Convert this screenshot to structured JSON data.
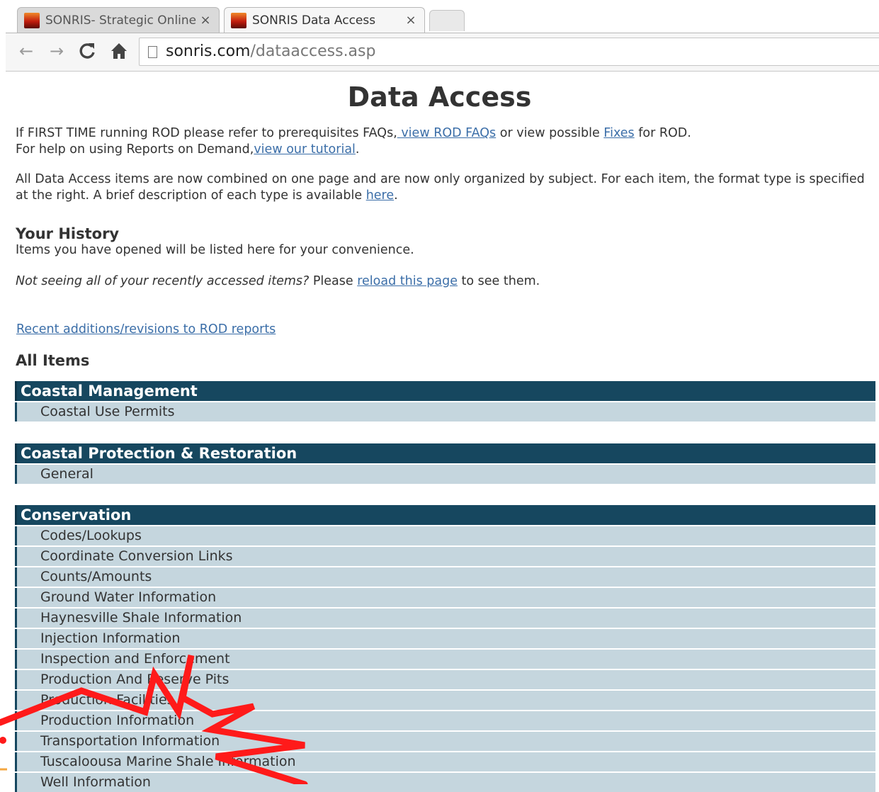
{
  "browser": {
    "tabs": [
      {
        "title": "SONRIS- Strategic Online",
        "close": "×"
      },
      {
        "title": "SONRIS Data Access",
        "close": "×"
      }
    ],
    "url_host": "sonris.com",
    "url_path": "/dataaccess.asp",
    "icons": {
      "back": "←",
      "forward": "→",
      "reload": "C",
      "home": "⌂"
    }
  },
  "page": {
    "title": "Data Access",
    "intro1": {
      "pre": "If FIRST TIME running ROD please refer to prerequisites FAQs,",
      "link1": " view ROD FAQs",
      "mid": " or view possible ",
      "link2": "Fixes",
      "post": " for ROD."
    },
    "intro2": {
      "pre": "For help on using Reports on Demand,",
      "link": "view our tutorial",
      "post": "."
    },
    "combined": {
      "line1": "All Data Access items are now combined on one page and are now only organized by subject. For each item, the format type is specified",
      "line2_pre": "at the right. A brief description of each type is available ",
      "line2_link": "here",
      "line2_post": "."
    },
    "history": {
      "heading": "Your History",
      "text": "Items you have opened will be listed here for your convenience.",
      "reload_italic": "Not seeing all of your recently accessed items?",
      "reload_pre": " Please ",
      "reload_link": "reload this page",
      "reload_post": " to see them."
    },
    "recent_link": "Recent additions/revisions to ROD reports",
    "all_items_heading": "All Items",
    "groups": [
      {
        "header": "Coastal Management",
        "items": [
          "Coastal Use Permits"
        ]
      },
      {
        "header": "Coastal Protection & Restoration",
        "items": [
          "General"
        ]
      },
      {
        "header": "Conservation",
        "items": [
          "Codes/Lookups",
          "Coordinate Conversion Links",
          "Counts/Amounts",
          "Ground Water Information",
          "Haynesville Shale Information",
          "Injection Information",
          "Inspection and Enforcement",
          "Production And Reserve Pits",
          "Production Facilities",
          "Production Information",
          "Transportation Information",
          "Tuscaloousa Marine Shale Information",
          "Well Information"
        ]
      }
    ]
  },
  "colors": {
    "group_header": "#16475f",
    "group_item": "#c5d6de",
    "link": "#3b6ea8",
    "annotation": "#ff1a1a"
  }
}
